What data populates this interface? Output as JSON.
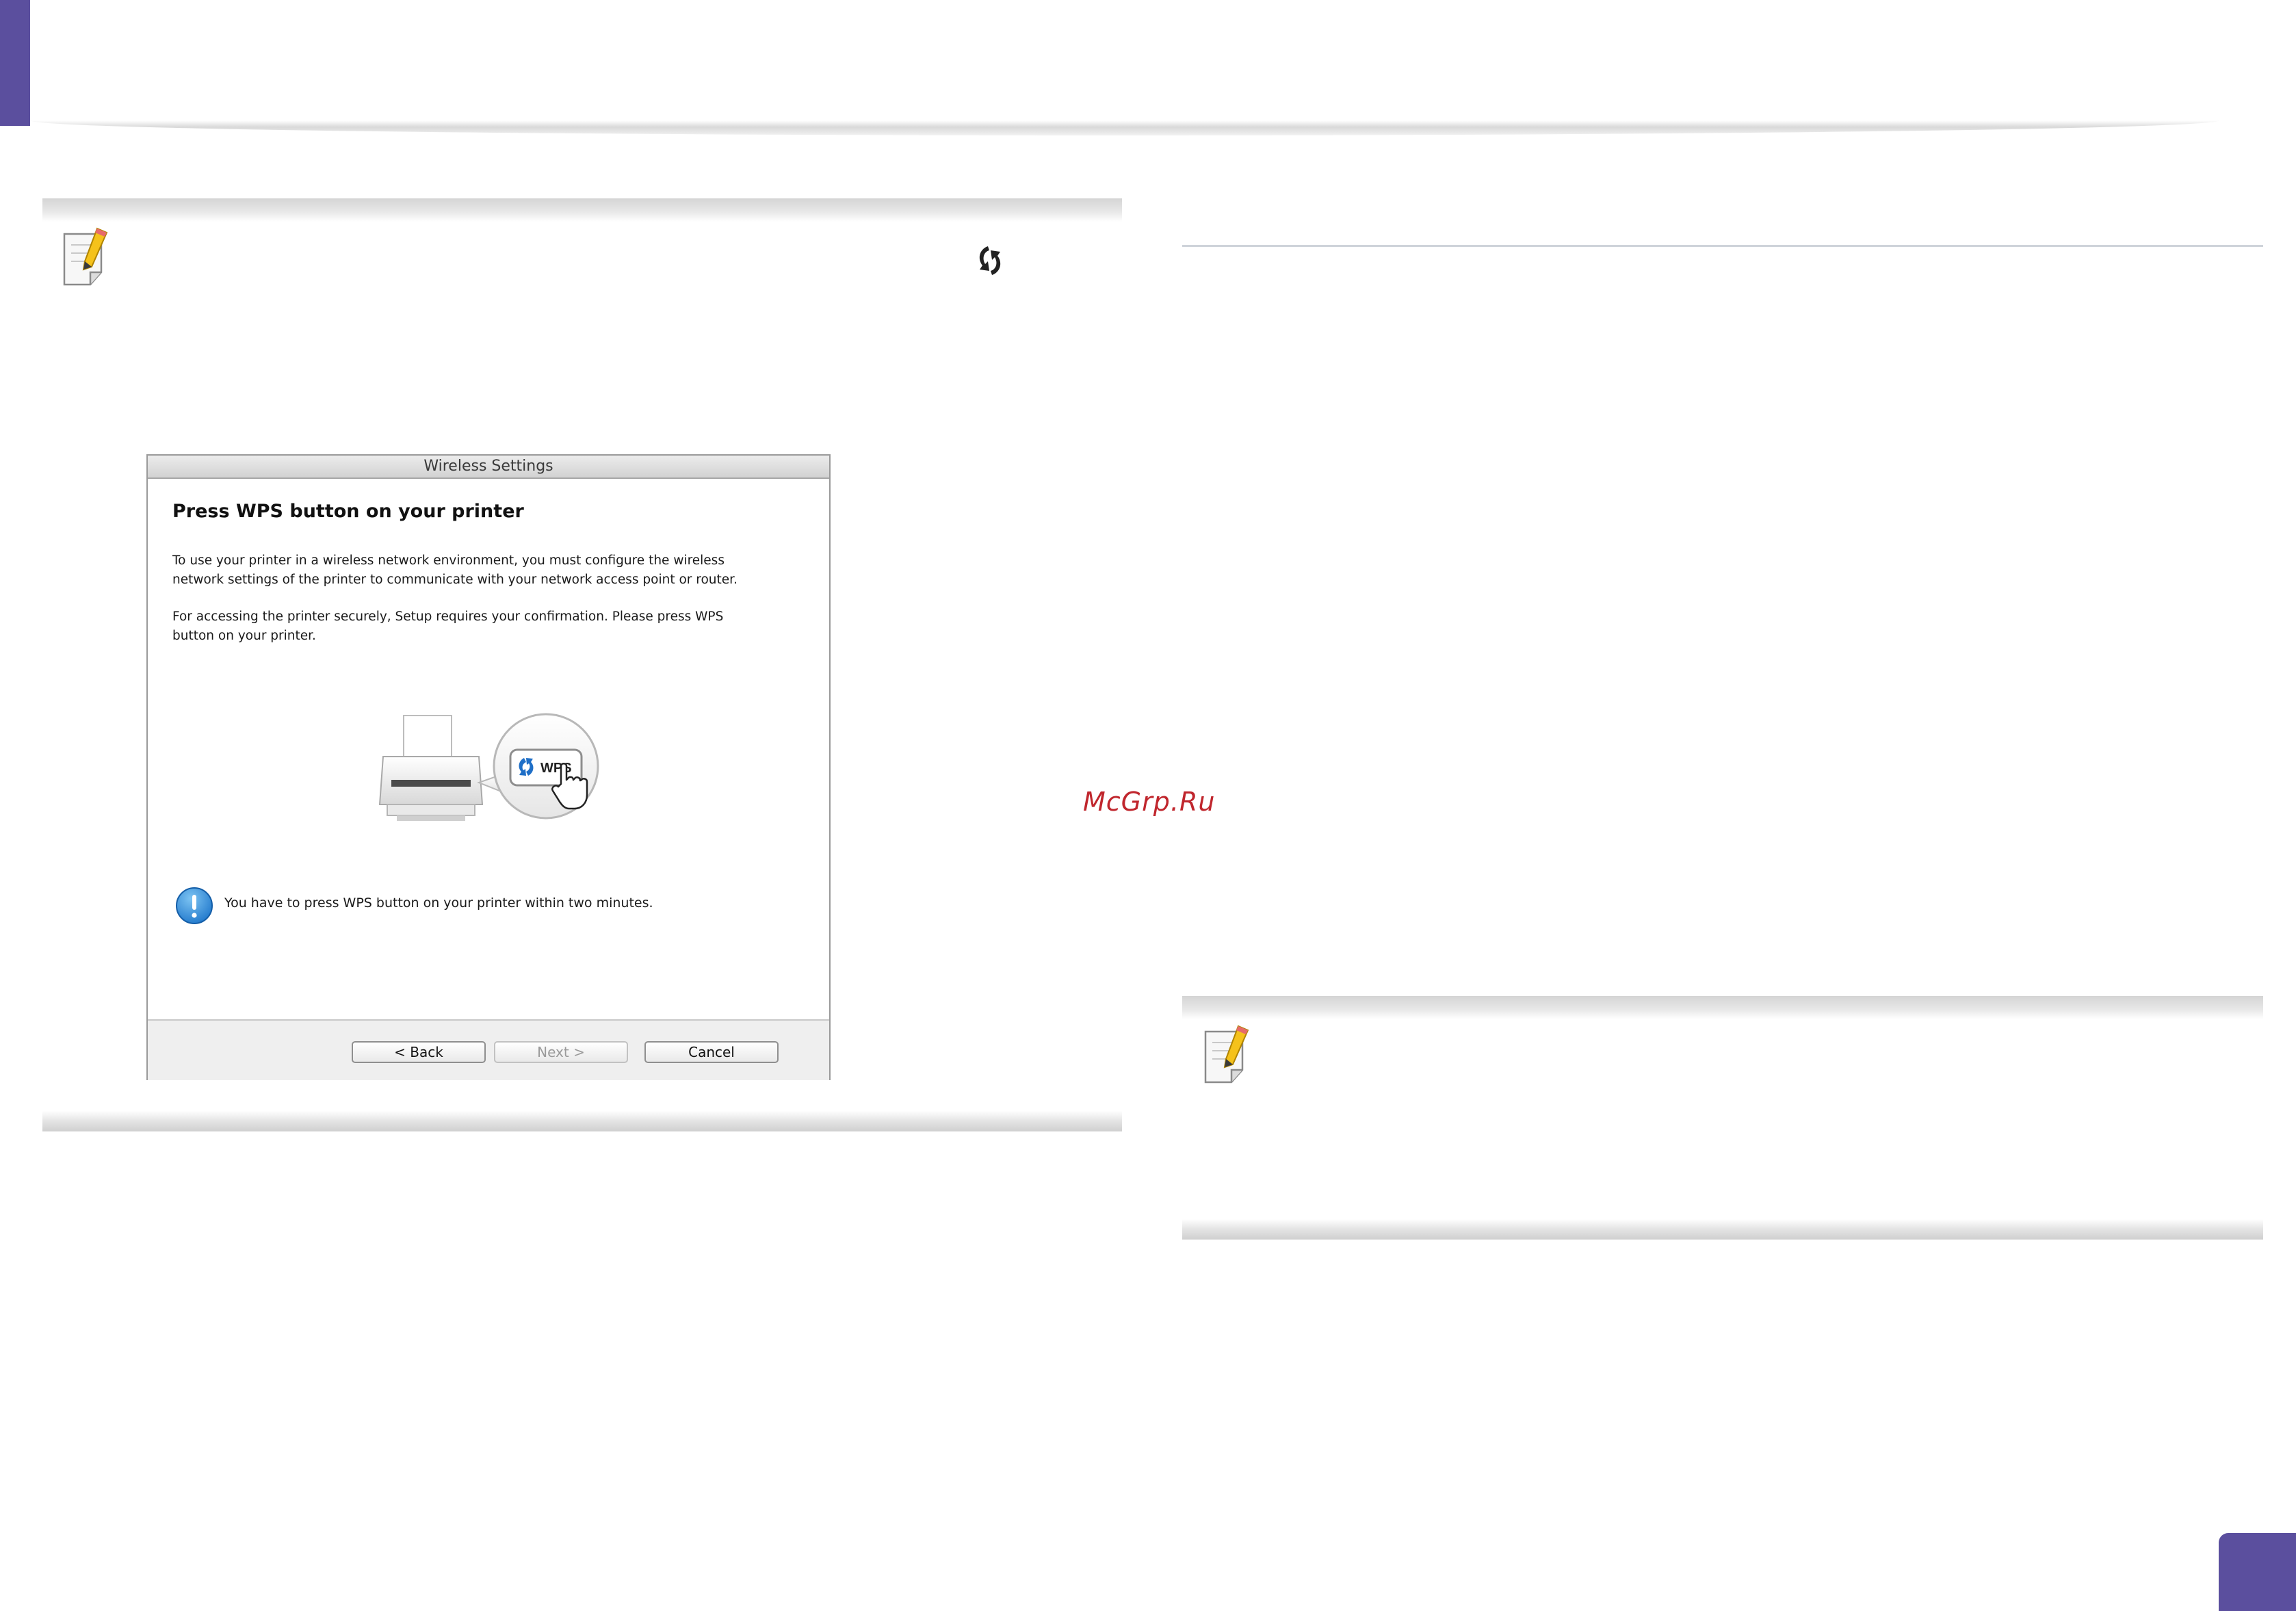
{
  "watermark": "McGrp.Ru",
  "dialog": {
    "title": "Wireless Settings",
    "heading": "Press WPS button on your printer",
    "para1_line1": "To use your printer in a wireless network environment, you must configure the wireless",
    "para1_line2": "network settings of the printer to communicate with your network access point or router.",
    "para2_line1": "For accessing the printer securely, Setup requires your confirmation. Please press WPS",
    "para2_line2": "button on your printer.",
    "wps_label": "WPS",
    "info_text": "You have to press WPS button on your printer within two minutes.",
    "buttons": {
      "back": "< Back",
      "next": "Next >",
      "cancel": "Cancel"
    }
  },
  "colors": {
    "accent": "#5b4f9e",
    "watermark": "#c0262d",
    "info_blue": "#2a8fd8"
  },
  "icons": {
    "note": "note-pencil-icon",
    "wps": "wps-icon",
    "info": "info-icon",
    "printer": "printer-icon",
    "hand": "hand-cursor-icon"
  }
}
